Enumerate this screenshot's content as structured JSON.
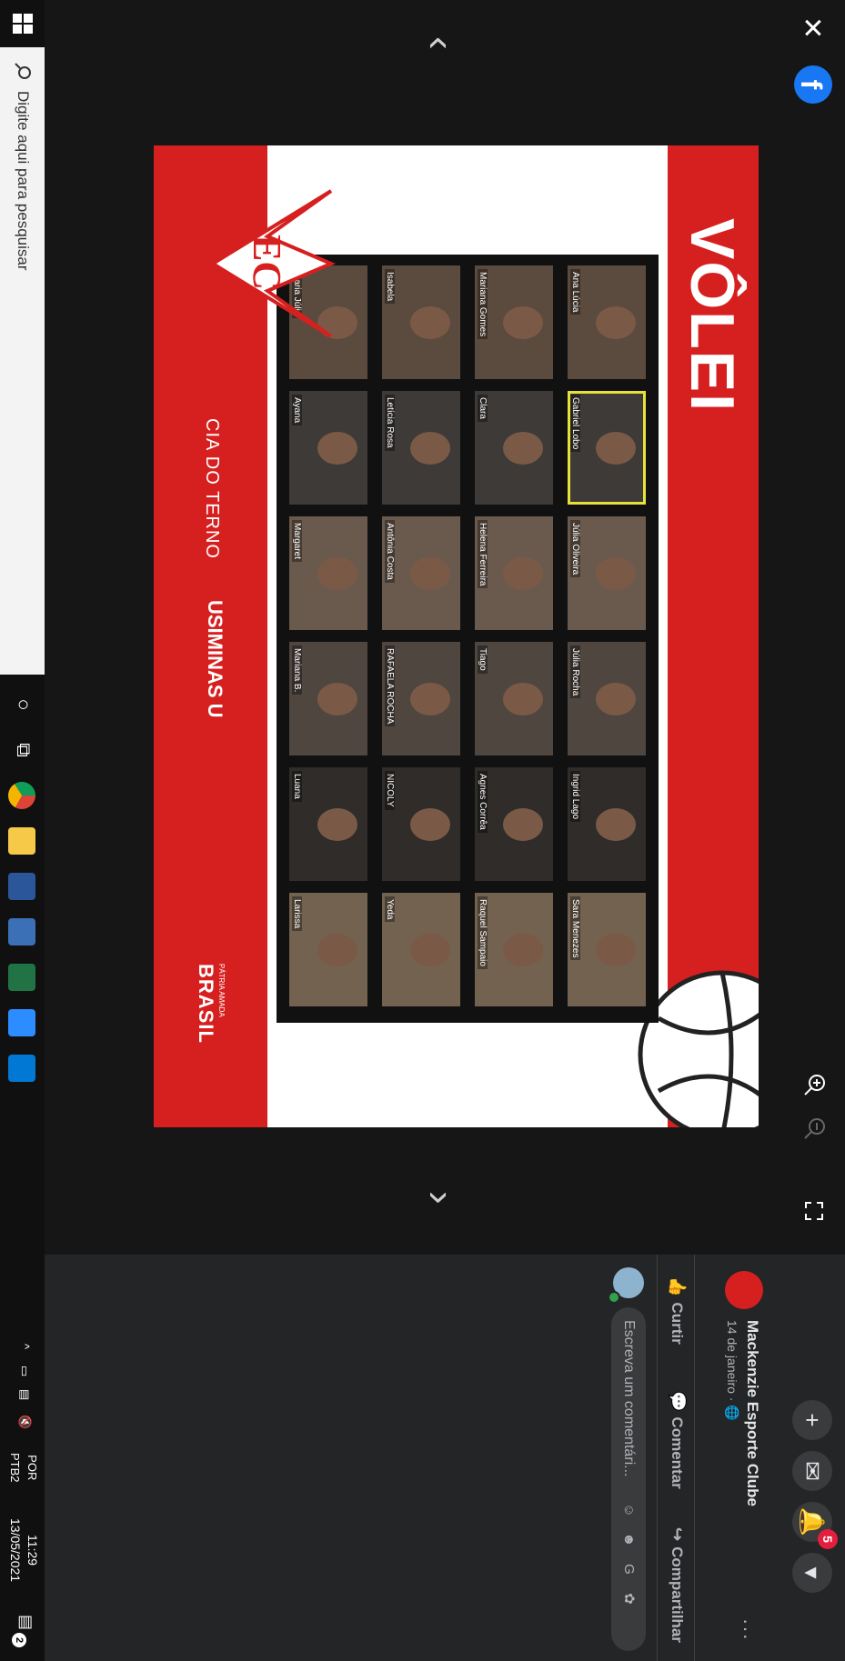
{
  "viewer": {
    "poster": {
      "title": "VÔLEI",
      "participants": [
        {
          "name": "Ana Lúcia"
        },
        {
          "name": "Gabriel Lobo"
        },
        {
          "name": "Júlia Oliveira"
        },
        {
          "name": "Júlia Rocha"
        },
        {
          "name": "Ingrid Lago"
        },
        {
          "name": "Sara Menezes"
        },
        {
          "name": "Mariana Gomes"
        },
        {
          "name": "Clara"
        },
        {
          "name": "Helena Ferreira"
        },
        {
          "name": "Tiago"
        },
        {
          "name": "Agnes Corrêa"
        },
        {
          "name": "Raquel Sampaio"
        },
        {
          "name": "Isabela"
        },
        {
          "name": "Letícia Rosa"
        },
        {
          "name": "Antônia Costa"
        },
        {
          "name": "RAFAELA ROCHA"
        },
        {
          "name": "NICOLY"
        },
        {
          "name": "Yeda"
        },
        {
          "name": "Maria Júlia"
        },
        {
          "name": "Ayana"
        },
        {
          "name": "Margaret"
        },
        {
          "name": "Mariana B."
        },
        {
          "name": "Luana"
        },
        {
          "name": "Larissa"
        }
      ],
      "sponsors": {
        "cia": "CIA DO TERNO",
        "usiminas": "USIMINAS U",
        "brasil": "BRASIL",
        "brasil_sub": "PÁTRIA AMADA"
      }
    }
  },
  "sidebar": {
    "page_name": "Mackenzie Esporte Clube",
    "post_date": "14 de janeiro · 🌐",
    "more": "···",
    "actions": {
      "like": "Curtir",
      "comment": "Comentar",
      "share": "Compartilhar"
    },
    "comment_placeholder": "Escreva um comentári...",
    "notification_count": "5",
    "top_icons": [
      "plus-icon",
      "messenger-icon",
      "bell-icon",
      "chevron-down-icon"
    ]
  },
  "taskbar": {
    "search_placeholder": "Digite aqui para pesquisar",
    "language": {
      "line1": "POR",
      "line2": "PTB2"
    },
    "time": "11:29",
    "date": "13/05/2021",
    "notification_badge": "2",
    "apps": [
      "chrome-icon",
      "file-explorer-icon",
      "word-icon",
      "calculator-icon",
      "excel-icon",
      "zoom-icon",
      "store-icon"
    ]
  },
  "colors": {
    "poster_red": "#d62020",
    "facebook_blue": "#1877f2",
    "sidebar_bg": "#242526"
  }
}
